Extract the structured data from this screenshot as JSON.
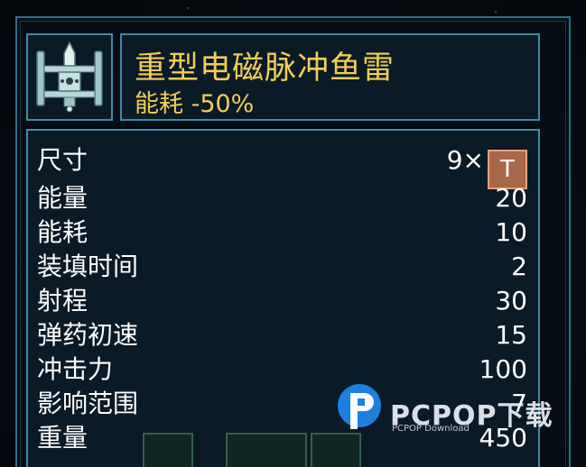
{
  "module": {
    "icon": "torpedo-module-icon",
    "title": "重型电磁脉冲鱼雷",
    "subtitle": "能耗 -50%"
  },
  "stats": {
    "size": {
      "label": "尺寸",
      "value": "9×",
      "badge": "T"
    },
    "energy": {
      "label": "能量",
      "value": "20"
    },
    "power_use": {
      "label": "能耗",
      "value": "10"
    },
    "reload": {
      "label": "装填时间",
      "value": "2"
    },
    "range": {
      "label": "射程",
      "value": "30"
    },
    "projectile_speed": {
      "label": "弹药初速",
      "value": "15"
    },
    "impact": {
      "label": "冲击力",
      "value": "100"
    },
    "area": {
      "label": "影响范围",
      "value": "7"
    },
    "weight": {
      "label": "重量",
      "value": "450"
    }
  },
  "watermark": {
    "brand": "PCPOP下载",
    "tagline": "PCPOP Download"
  },
  "colors": {
    "frame": "#2d6f8a",
    "panel_border": "#3f8aa8",
    "title": "#f1cd55",
    "size_badge": "#a9674a"
  }
}
